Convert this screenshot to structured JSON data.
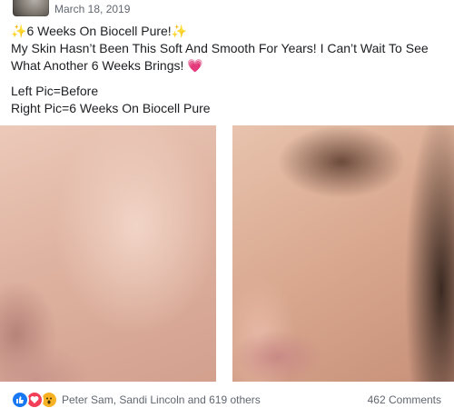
{
  "post": {
    "date": "March 18, 2019",
    "lines": [
      {
        "prefix": "✨",
        "text": "6 Weeks On Biocell Pure!",
        "suffix": "✨"
      },
      {
        "text": "My Skin Hasn’t Been This Soft And Smooth For Years! I Can’t Wait To See"
      },
      {
        "text": "What Another 6 Weeks Brings! ",
        "suffix": "💗"
      },
      {
        "text": "Left Pic=Before"
      },
      {
        "text": "Right Pic=6 Weeks On Biocell Pure"
      }
    ]
  },
  "photos": {
    "left_icon": "photo-before",
    "right_icon": "photo-after"
  },
  "footer": {
    "reactions": [
      "like-icon",
      "love-icon",
      "wow-icon"
    ],
    "likers": "Peter Sam, Sandi Lincoln and 619 others",
    "comments": "462 Comments"
  },
  "colors": {
    "like": "#1877f2",
    "love": "#f33e58",
    "wow": "#f7b125",
    "meta_text": "#616770"
  }
}
